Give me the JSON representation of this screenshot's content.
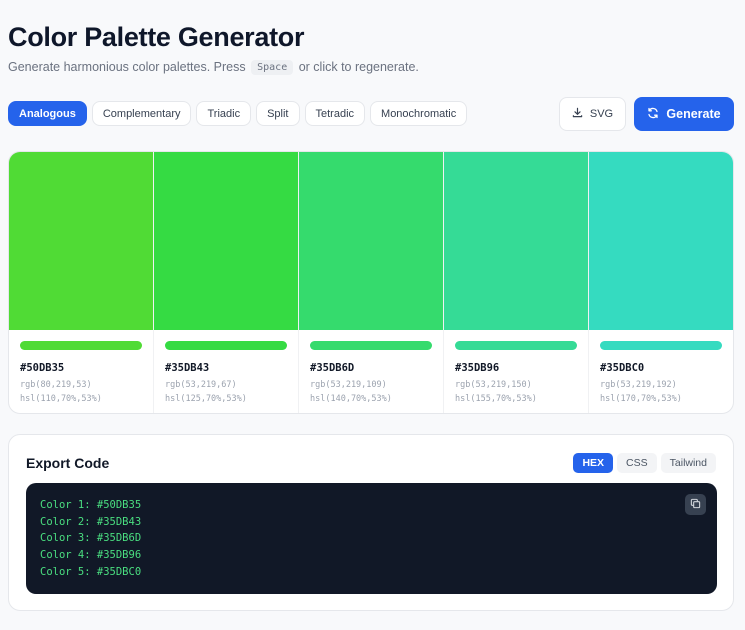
{
  "header": {
    "title": "Color Palette Generator",
    "subtitle_before": "Generate harmonious color palettes. Press",
    "subtitle_key": "Space",
    "subtitle_after": "or click to regenerate."
  },
  "tabs": [
    {
      "label": "Analogous",
      "active": true
    },
    {
      "label": "Complementary",
      "active": false
    },
    {
      "label": "Triadic",
      "active": false
    },
    {
      "label": "Split",
      "active": false
    },
    {
      "label": "Tetradic",
      "active": false
    },
    {
      "label": "Monochromatic",
      "active": false
    }
  ],
  "actions": {
    "svg_label": "SVG",
    "svg_icon": "download-icon",
    "generate_label": "Generate",
    "generate_icon": "refresh-icon"
  },
  "colors": {
    "accent": "#2563eb",
    "code_bg": "#111827",
    "code_text": "#4ade80"
  },
  "palette": [
    {
      "hex": "#50DB35",
      "rgb": "rgb(80,219,53)",
      "hsl": "hsl(110,70%,53%)"
    },
    {
      "hex": "#35DB43",
      "rgb": "rgb(53,219,67)",
      "hsl": "hsl(125,70%,53%)"
    },
    {
      "hex": "#35DB6D",
      "rgb": "rgb(53,219,109)",
      "hsl": "hsl(140,70%,53%)"
    },
    {
      "hex": "#35DB96",
      "rgb": "rgb(53,219,150)",
      "hsl": "hsl(155,70%,53%)"
    },
    {
      "hex": "#35DBC0",
      "rgb": "rgb(53,219,192)",
      "hsl": "hsl(170,70%,53%)"
    }
  ],
  "export": {
    "title": "Export Code",
    "formats": [
      {
        "label": "HEX",
        "active": true
      },
      {
        "label": "CSS",
        "active": false
      },
      {
        "label": "Tailwind",
        "active": false
      }
    ],
    "code_lines": [
      "Color 1: #50DB35",
      "Color 2: #35DB43",
      "Color 3: #35DB6D",
      "Color 4: #35DB96",
      "Color 5: #35DBC0"
    ],
    "copy_icon": "copy-icon"
  }
}
